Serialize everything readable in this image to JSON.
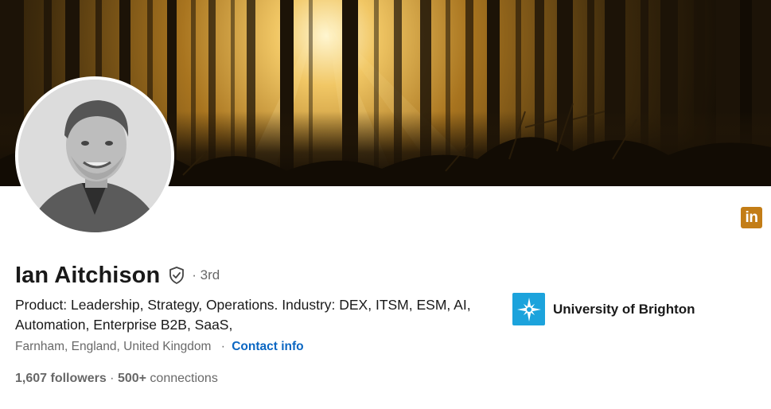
{
  "profile": {
    "name": "Ian Aitchison",
    "degree": "· 3rd",
    "headline": "Product: Leadership, Strategy, Operations. Industry: DEX, ITSM, ESM, AI, Automation, Enterprise B2B, SaaS,",
    "location": "Farnham, England, United Kingdom",
    "location_separator": "·",
    "contact_info_label": "Contact info",
    "followers": "1,607 followers",
    "stats_separator": " · ",
    "connections_count": "500+",
    "connections_label": " connections"
  },
  "education": {
    "name": "University of Brighton",
    "logo_icon": "star-compass-icon",
    "logo_color": "#1ca3dc"
  },
  "badge": {
    "label": "in",
    "color": "#c37d16"
  },
  "colors": {
    "link": "#0a66c2",
    "secondary_text": "rgba(0,0,0,0.6)",
    "primary_text": "rgba(0,0,0,0.9)"
  }
}
